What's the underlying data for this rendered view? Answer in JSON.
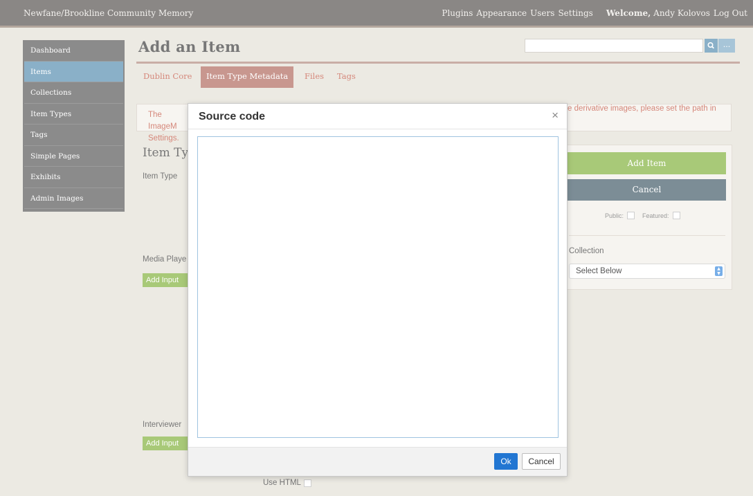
{
  "topbar": {
    "site_title": "Newfane/Brookline Community Memory",
    "links": [
      "Plugins",
      "Appearance",
      "Users",
      "Settings"
    ],
    "welcome_label": "Welcome,",
    "user_name": "Andy Kolovos",
    "logout": "Log Out"
  },
  "sidenav": {
    "items": [
      {
        "label": "Dashboard"
      },
      {
        "label": "Items"
      },
      {
        "label": "Collections"
      },
      {
        "label": "Item Types"
      },
      {
        "label": "Tags"
      },
      {
        "label": "Simple Pages"
      },
      {
        "label": "Exhibits"
      },
      {
        "label": "Admin Images"
      }
    ],
    "active": "Items"
  },
  "header": {
    "page_title": "Add an Item",
    "search_placeholder": "",
    "search_options_label": "..."
  },
  "tabs": [
    {
      "label": "Dublin Core"
    },
    {
      "label": "Item Type Metadata",
      "active": true
    },
    {
      "label": "Files"
    },
    {
      "label": "Tags"
    }
  ],
  "notice": {
    "left_text": "The ImageM Settings.",
    "right_text": "e derivative images, please set the path in"
  },
  "form": {
    "section_title": "Item Typ",
    "item_type_label": "Item Type",
    "media_player_label": "Media Playe",
    "interviewer_label": "Interviewer",
    "add_input_label": "Add Input",
    "use_html_label": "Use HTML"
  },
  "right_panel": {
    "add_item": "Add Item",
    "cancel": "Cancel",
    "public_label": "Public:",
    "featured_label": "Featured:",
    "collection_label": "Collection",
    "collection_value": "Select Below"
  },
  "modal": {
    "title": "Source code",
    "close_glyph": "×",
    "textarea_value": "",
    "ok": "Ok",
    "cancel": "Cancel"
  },
  "colors": {
    "topbar": "#8a8785",
    "sidenav": "#8b8b8b",
    "active_nav": "#8ab0c8",
    "accent": "#d5877a",
    "green_button": "#a8c978",
    "ok_button": "#2276d2"
  }
}
